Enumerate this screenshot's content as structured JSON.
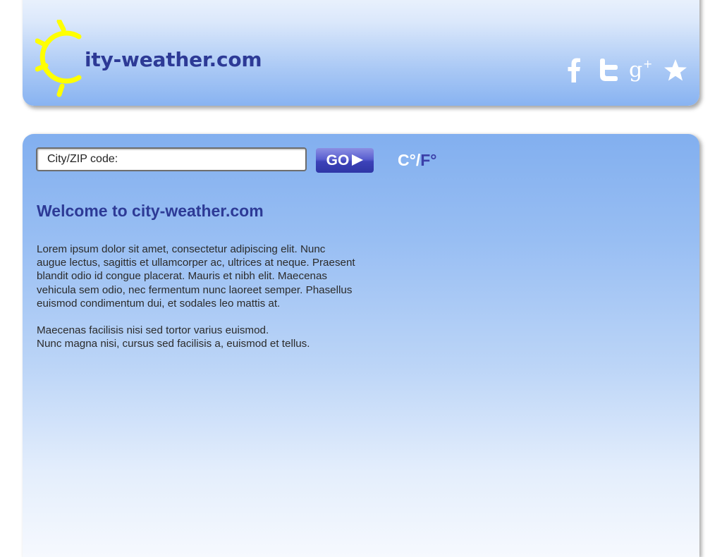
{
  "header": {
    "logo_text": "ity-weather.com",
    "social": [
      {
        "name": "facebook",
        "icon": "facebook-icon",
        "label": "f"
      },
      {
        "name": "twitter",
        "icon": "twitter-icon",
        "label": "t"
      },
      {
        "name": "google-plus",
        "icon": "google-plus-icon",
        "label": "g+"
      },
      {
        "name": "favorite",
        "icon": "star-icon",
        "label": "★"
      }
    ]
  },
  "search": {
    "placeholder": "City/ZIP code:",
    "value": "",
    "go_label": "GO"
  },
  "units": {
    "celsius": "C°",
    "separator": "/",
    "fahrenheit": "F°"
  },
  "content": {
    "title": "Welcome to city-weather.com",
    "paragraph_1_lines": [
      "Lorem ipsum dolor sit amet, consectetur adipiscing elit. Nunc",
      "augue lectus, sagittis et ullamcorper ac, ultrices at neque. Praesent",
      "blandit odio id congue placerat. Mauris et nibh elit. Maecenas",
      "vehicula sem odio, nec fermentum nunc laoreet semper. Phasellus",
      "euismod condimentum dui, et sodales leo mattis at."
    ],
    "paragraph_2_lines": [
      "Maecenas facilisis nisi sed tortor varius euismod.",
      "Nunc magna nisi, cursus sed facilisis a, euismod et tellus."
    ]
  },
  "colors": {
    "brand_text": "#2d3a96",
    "sun": "#ffff00",
    "icon": "#ffffff",
    "go_button": "#3c42b8",
    "fahrenheit": "#3b3fa8"
  }
}
